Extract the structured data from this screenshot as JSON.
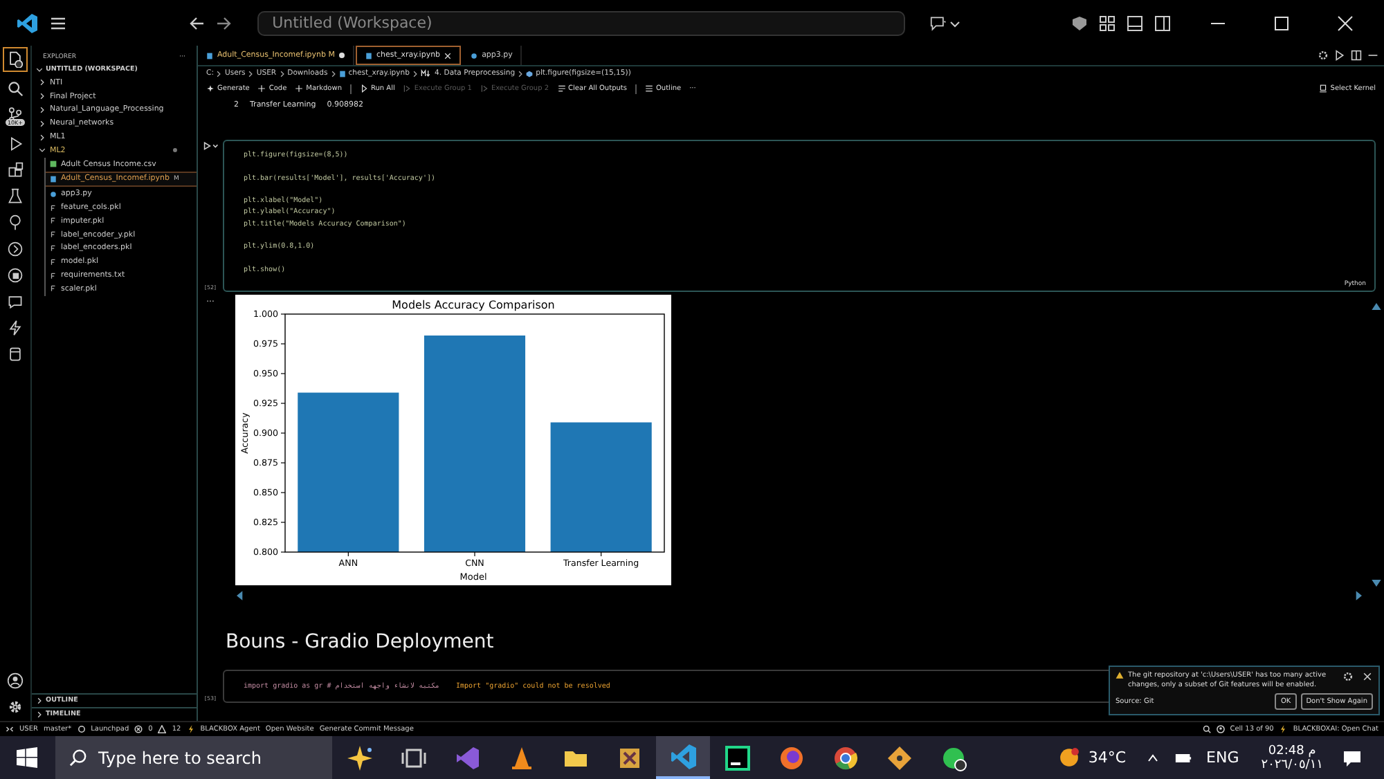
{
  "title_bar": {
    "search": "Untitled (Workspace)"
  },
  "activity_bar": {
    "badge": "10K+"
  },
  "sidebar": {
    "title": "EXPLORER",
    "more": "···",
    "workspace": "UNTITLED (WORKSPACE)",
    "items": [
      {
        "label": "NTI",
        "expanded": false,
        "selected": false
      },
      {
        "label": "Final Project",
        "expanded": false,
        "selected": false
      },
      {
        "label": "Natural_Language_Processing",
        "expanded": false,
        "selected": false
      },
      {
        "label": "Neural_networks",
        "expanded": false,
        "selected": false
      },
      {
        "label": "ML1",
        "expanded": false,
        "selected": false
      },
      {
        "label": "ML2",
        "expanded": true,
        "selected": false,
        "modified": true,
        "children": [
          {
            "label": "Adult Census Income.csv",
            "kind": "csv",
            "selected": false
          },
          {
            "label": "Adult_Census_Incomef.ipynb",
            "kind": "notebook",
            "selected": true,
            "badge": "M"
          },
          {
            "label": "app3.py",
            "kind": "python",
            "selected": false
          },
          {
            "label": "feature_cols.pkl",
            "kind": "file",
            "selected": false
          },
          {
            "label": "imputer.pkl",
            "kind": "file",
            "selected": false
          },
          {
            "label": "label_encoder_y.pkl",
            "kind": "file",
            "selected": false
          },
          {
            "label": "label_encoders.pkl",
            "kind": "file",
            "selected": false
          },
          {
            "label": "model.pkl",
            "kind": "file",
            "selected": false
          },
          {
            "label": "requirements.txt",
            "kind": "file",
            "selected": false
          },
          {
            "label": "scaler.pkl",
            "kind": "file",
            "selected": false
          }
        ]
      }
    ],
    "bottom_sections": [
      "OUTLINE",
      "TIMELINE"
    ]
  },
  "tabs": [
    {
      "label": "Adult_Census_Incomef.ipynb",
      "badge": "M",
      "modified": true,
      "selected": false,
      "kind": "notebook"
    },
    {
      "label": "chest_xray.ipynb",
      "modified": false,
      "selected": true,
      "kind": "notebook"
    },
    {
      "label": "app3.py",
      "modified": false,
      "selected": false,
      "kind": "python"
    }
  ],
  "breadcrumb": [
    "C:",
    "Users",
    "USER",
    "Downloads",
    "chest_xray.ipynb",
    "4. Data Preprocessing",
    "plt.figure(figsize=(15,15))"
  ],
  "toolbar": {
    "items": [
      {
        "label": "Generate",
        "kind": "sparkle",
        "disabled": false
      },
      {
        "label": "Code",
        "kind": "plus",
        "disabled": false
      },
      {
        "label": "Markdown",
        "kind": "plus",
        "disabled": false
      },
      {
        "label": "Run All",
        "kind": "run",
        "disabled": false
      },
      {
        "label": "Execute Group 1",
        "kind": "group",
        "disabled": true
      },
      {
        "label": "Execute Group 2",
        "kind": "group",
        "disabled": true
      },
      {
        "label": "Clear All Outputs",
        "kind": "clear",
        "disabled": false
      },
      {
        "label": "Outline",
        "kind": "list",
        "disabled": false
      }
    ],
    "more": "···",
    "kernel": "Select Kernel"
  },
  "output_line": {
    "index": "2",
    "name": "Transfer Learning",
    "value": "0.908982"
  },
  "cells": [
    {
      "kind": "code",
      "count": "[52]",
      "language": "Python",
      "blocks": [
        [
          "plt.figure(figsize=(8,5))"
        ],
        [
          "plt.bar(results['Model'], results['Accuracy'])"
        ],
        [
          "plt.xlabel(\"Model\")",
          "plt.ylabel(\"Accuracy\")",
          "plt.title(\"Models Accuracy Comparison\")"
        ],
        [
          "plt.ylim(0.8,1.0)"
        ],
        [
          "plt.show()"
        ]
      ],
      "output_more": "...",
      "chart_data": {
        "type": "bar",
        "title": "Models Accuracy Comparison",
        "xlabel": "Model",
        "ylabel": "Accuracy",
        "categories": [
          "ANN",
          "CNN",
          "Transfer Learning"
        ],
        "series": [
          {
            "color": "#1f77b4",
            "values": [
              0.934,
              0.982,
              0.909
            ]
          }
        ],
        "ylim": [
          0.8,
          1.0
        ],
        "yticks": [
          {
            "value": 0.8,
            "label": "0.800"
          },
          {
            "value": 0.825,
            "label": "0.825"
          },
          {
            "value": 0.85,
            "label": "0.850"
          },
          {
            "value": 0.875,
            "label": "0.875"
          },
          {
            "value": 0.9,
            "label": "0.900"
          },
          {
            "value": 0.925,
            "label": "0.925"
          },
          {
            "value": 0.95,
            "label": "0.950"
          },
          {
            "value": 0.975,
            "label": "0.975"
          },
          {
            "value": 1.0,
            "label": "1.000"
          }
        ]
      }
    },
    {
      "kind": "markdown",
      "heading": "Bouns - Gradio Deployment"
    },
    {
      "kind": "code",
      "count": "[53]",
      "code": "import gradio as gr # مكتبه لانشاء واجهه استخدام",
      "warning": "Import \"gradio\" could not be resolved"
    }
  ],
  "notification": {
    "message": "The git repository at 'c:\\Users\\USER' has too many active changes, only a subset of Git features will be enabled.",
    "source": "Source: Git",
    "buttons": [
      "OK",
      "Don't Show Again"
    ]
  },
  "status_bar": {
    "left": [
      "USER",
      "master*",
      "Launchpad"
    ],
    "errors": "0",
    "warnings": "12",
    "extensions": [
      "BLACKBOX Agent",
      "Open Website",
      "Generate Commit Message"
    ],
    "cell": "Cell 13 of 90",
    "chat": "BLACKBOXAI: Open Chat"
  },
  "taskbar": {
    "search": "Type here to search",
    "weather": "34°C",
    "language": "ENG",
    "time": "02:48 م",
    "date": "٢٠٢٦/٠٥/١١",
    "apps": [
      {
        "kind": "copilot",
        "selected": false
      },
      {
        "kind": "taskview",
        "selected": false
      },
      {
        "kind": "vs",
        "selected": false
      },
      {
        "kind": "vlc",
        "selected": false
      },
      {
        "kind": "folder",
        "selected": false
      },
      {
        "kind": "tools",
        "selected": false
      },
      {
        "kind": "vscode",
        "selected": true
      },
      {
        "kind": "pycharm",
        "selected": false
      },
      {
        "kind": "firefox",
        "selected": false
      },
      {
        "kind": "chrome",
        "selected": false
      },
      {
        "kind": "git",
        "selected": false
      },
      {
        "kind": "whatsapp",
        "selected": false
      }
    ]
  }
}
